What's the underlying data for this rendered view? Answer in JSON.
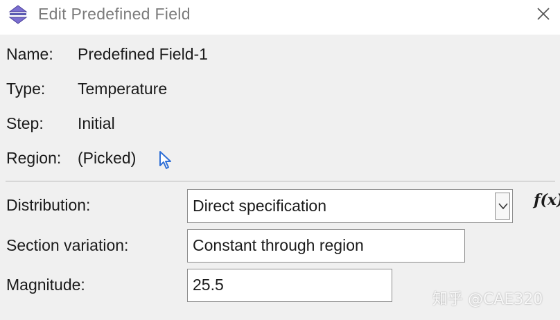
{
  "window": {
    "title": "Edit Predefined Field",
    "icon": "predefined-field-app-icon",
    "close_icon": "close-icon"
  },
  "info": {
    "name_label": "Name:",
    "name_value": "Predefined Field-1",
    "type_label": "Type:",
    "type_value": "Temperature",
    "step_label": "Step:",
    "step_value": "Initial",
    "region_label": "Region:",
    "region_value": "(Picked)",
    "region_pick_icon": "arrow-cursor-icon"
  },
  "form": {
    "distribution_label": "Distribution:",
    "distribution_value": "Direct specification",
    "section_variation_label": "Section variation:",
    "section_variation_value": "Constant through region",
    "magnitude_label": "Magnitude:",
    "magnitude_value": "25.5",
    "fx_label": "f(x)"
  },
  "watermark": "知乎 @CAE320",
  "colors": {
    "window_bg": "#f0f0f0",
    "titlebar_bg": "#ffffff",
    "title_text": "#7a7a7a",
    "pick_icon": "#2f6fd6",
    "app_icon": "#6a5acd"
  }
}
